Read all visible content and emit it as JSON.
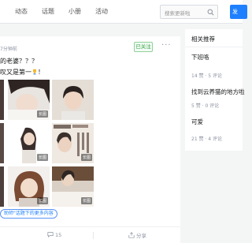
{
  "nav": {
    "items": [
      "动态",
      "话题",
      "小册",
      "活动"
    ]
  },
  "search": {
    "placeholder": "搜索更新啦"
  },
  "publish_label": "发",
  "post": {
    "time": "7分钟前",
    "follow_label": "已关注",
    "more_label": "···",
    "line1": "的老婆？？？",
    "line2": "叹又是第一",
    "line2_end": "！",
    "photo_tag": "长图",
    "topic_link": "助师\"话题下的更多内容",
    "comments": "15",
    "share": "分享"
  },
  "sidebar": {
    "title": "相关推荐",
    "items": [
      {
        "title": "下班咯",
        "meta": "14 赞 · 5 评论"
      },
      {
        "title": "找到云养猫的地方啦",
        "meta": "5 赞 · 0 评论"
      },
      {
        "title": "可爱",
        "meta": "21 赞 · 4 评论"
      }
    ]
  },
  "colors": {
    "brand_blue": "#1e80ff",
    "follow_green": "#37a648",
    "page_bg": "#f4f5f5"
  },
  "icons": [
    "search-icon",
    "trophy-icon",
    "comment-icon",
    "share-icon",
    "more-icon"
  ]
}
